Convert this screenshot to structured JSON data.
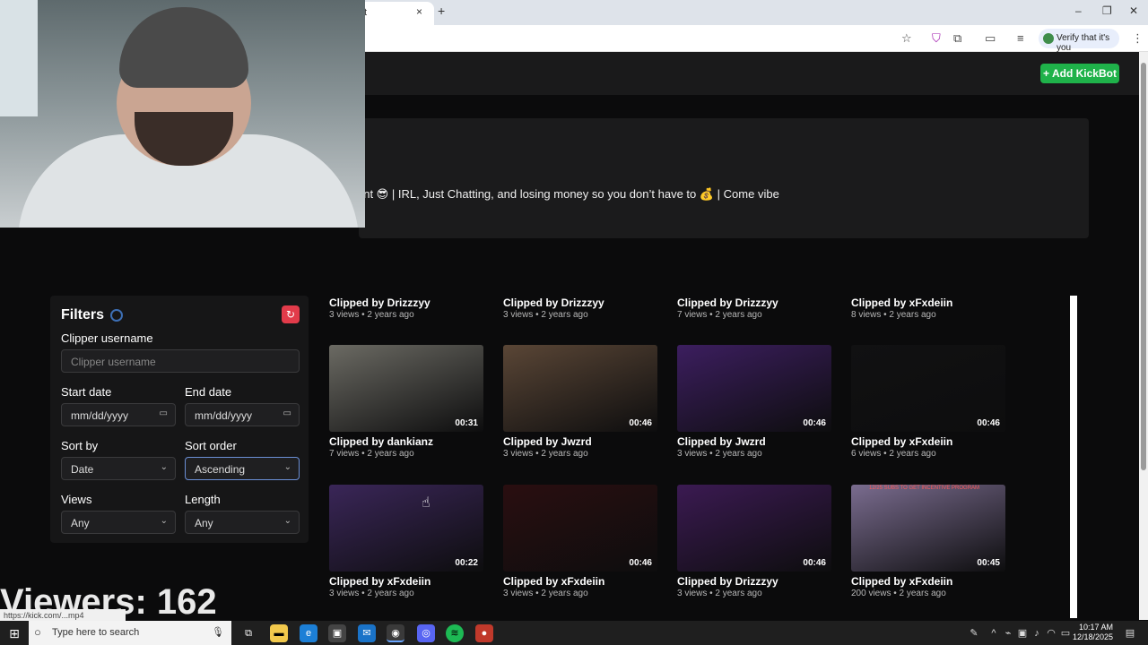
{
  "browser": {
    "tab_title": "t",
    "tab_close": "×",
    "new_tab": "+",
    "verify_label": "Verify that it's you",
    "window_controls": [
      "–",
      "❐",
      "✕"
    ]
  },
  "header": {
    "add_kickbot_label": "+ Add KickBot"
  },
  "channel": {
    "description": "ent 😎 | IRL, Just Chatting, and losing money so you don’t have to 💰 | Come vibe"
  },
  "filters": {
    "title": "Filters",
    "clipper_label": "Clipper username",
    "clipper_placeholder": "Clipper username",
    "start_label": "Start date",
    "start_value": "mm/dd/yyyy",
    "end_label": "End date",
    "end_value": "mm/dd/yyyy",
    "sort_by_label": "Sort by",
    "sort_by_value": "Date",
    "sort_order_label": "Sort order",
    "sort_order_value": "Ascending",
    "views_label": "Views",
    "views_value": "Any",
    "length_label": "Length",
    "length_value": "Any"
  },
  "top_row": [
    {
      "title": "Clipped by Drizzzyy",
      "meta": "3 views • 2 years ago"
    },
    {
      "title": "Clipped by Drizzzyy",
      "meta": "3 views • 2 years ago"
    },
    {
      "title": "Clipped by Drizzzyy",
      "meta": "7 views • 2 years ago"
    },
    {
      "title": "Clipped by xFxdeiin",
      "meta": "8 views • 2 years ago"
    }
  ],
  "clips": [
    {
      "duration": "00:31",
      "title": "Clipped by dankianz",
      "meta": "7 views • 2 years ago",
      "color": "#6b6a63"
    },
    {
      "duration": "00:46",
      "title": "Clipped by Jwzrd",
      "meta": "3 views • 2 years ago",
      "color": "#5a4636"
    },
    {
      "duration": "00:46",
      "title": "Clipped by Jwzrd",
      "meta": "3 views • 2 years ago",
      "color": "#3c1e5f"
    },
    {
      "duration": "00:46",
      "title": "Clipped by xFxdeiin",
      "meta": "6 views • 2 years ago",
      "color": "#111112"
    },
    {
      "duration": "00:22",
      "title": "Clipped by xFxdeiin",
      "meta": "3 views • 2 years ago",
      "color": "#3a2658"
    },
    {
      "duration": "00:46",
      "title": "Clipped by xFxdeiin",
      "meta": "3 views • 2 years ago",
      "color": "#2a0e10"
    },
    {
      "duration": "00:46",
      "title": "Clipped by Drizzzyy",
      "meta": "3 views • 2 years ago",
      "color": "#3b1a52"
    },
    {
      "duration": "00:45",
      "title": "Clipped by xFxdeiin",
      "meta": "200 views • 2 years ago",
      "color": "#7a6c8f"
    }
  ],
  "thumb_overlay_text": "12/25 SUBS TO GET INCENTIVE PROGRAM",
  "viewers": "Viewers: 162",
  "status_url": "https://kick.com/...mp4",
  "taskbar": {
    "search_placeholder": "Type here to search",
    "time": "10:17 AM",
    "date": "12/18/2025"
  }
}
